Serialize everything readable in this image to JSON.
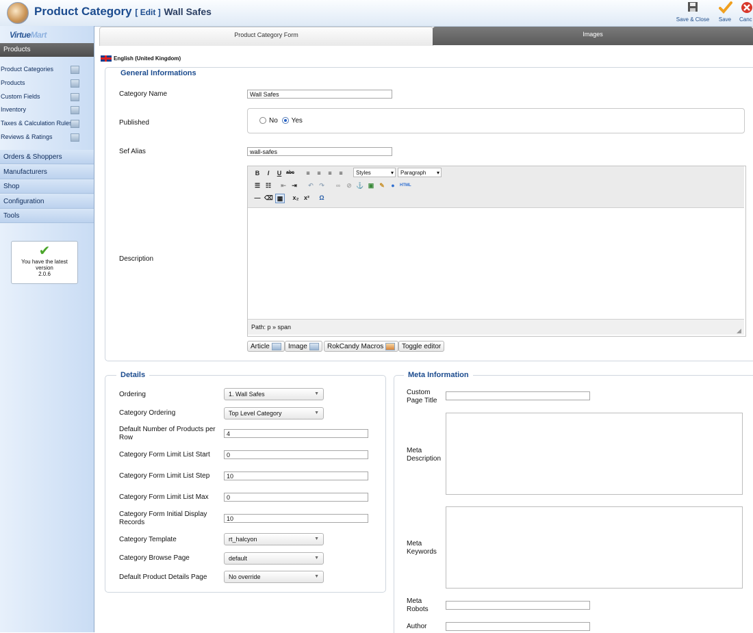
{
  "header": {
    "title": "Product Category",
    "subtitle": "[ Edit ]",
    "record_name": "Wall Safes",
    "toolbar": {
      "save_close_label": "Save & Close",
      "save_label": "Save",
      "cancel_label": "Canc"
    }
  },
  "sidebar": {
    "logo_text_a": "Virtue",
    "logo_text_b": "Mart",
    "section_products": "Products",
    "items": [
      {
        "label": "Product Categories",
        "icon": "categories-icon"
      },
      {
        "label": "Products",
        "icon": "products-icon"
      },
      {
        "label": "Custom Fields",
        "icon": "custom-fields-icon"
      },
      {
        "label": "Inventory",
        "icon": "inventory-icon"
      },
      {
        "label": "Taxes & Calculation Rules",
        "icon": "calculator-icon"
      },
      {
        "label": "Reviews & Ratings",
        "icon": "reviews-icon"
      }
    ],
    "menus": [
      "Orders & Shoppers",
      "Manufacturers",
      "Shop",
      "Configuration",
      "Tools"
    ],
    "version_notice": {
      "line1": "You have the latest",
      "line2": "version",
      "line3": "2.0.6"
    }
  },
  "tabs": {
    "form": "Product Category Form",
    "images": "Images"
  },
  "language": "English (United Kingdom)",
  "general": {
    "legend": "General Informations",
    "category_name_label": "Category Name",
    "category_name_value": "Wall Safes",
    "published_label": "Published",
    "published_no": "No",
    "published_yes": "Yes",
    "published_selected": "Yes",
    "sef_alias_label": "Sef Alias",
    "sef_alias_value": "wall-safes",
    "description_label": "Description",
    "editor": {
      "styles_dropdown": "Styles",
      "format_dropdown": "Paragraph",
      "path_text": "Path: p » span"
    },
    "editor_buttons": [
      "Article",
      "Image",
      "RokCandy Macros",
      "Toggle editor"
    ]
  },
  "details": {
    "legend": "Details",
    "ordering_label": "Ordering",
    "ordering_value": "1. Wall Safes",
    "category_ordering_label": "Category Ordering",
    "category_ordering_value": "Top Level Category",
    "products_per_row_label": "Default Number of Products per Row",
    "products_per_row_value": "4",
    "limit_start_label": "Category Form Limit List Start",
    "limit_start_value": "0",
    "limit_step_label": "Category Form Limit List Step",
    "limit_step_value": "10",
    "limit_max_label": "Category Form Limit List Max",
    "limit_max_value": "0",
    "initial_display_label": "Category Form Initial Display Records",
    "initial_display_value": "10",
    "template_label": "Category Template",
    "template_value": "rt_halcyon",
    "browse_page_label": "Category Browse Page",
    "browse_page_value": "default",
    "product_details_label": "Default Product Details Page",
    "product_details_value": "No override"
  },
  "meta": {
    "legend": "Meta Information",
    "custom_title_label_1": "Custom",
    "custom_title_label_2": "Page Title",
    "description_label_1": "Meta",
    "description_label_2": "Description",
    "keywords_label_1": "Meta",
    "keywords_label_2": "Keywords",
    "robots_label_1": "Meta",
    "robots_label_2": "Robots",
    "author_label": "Author"
  }
}
